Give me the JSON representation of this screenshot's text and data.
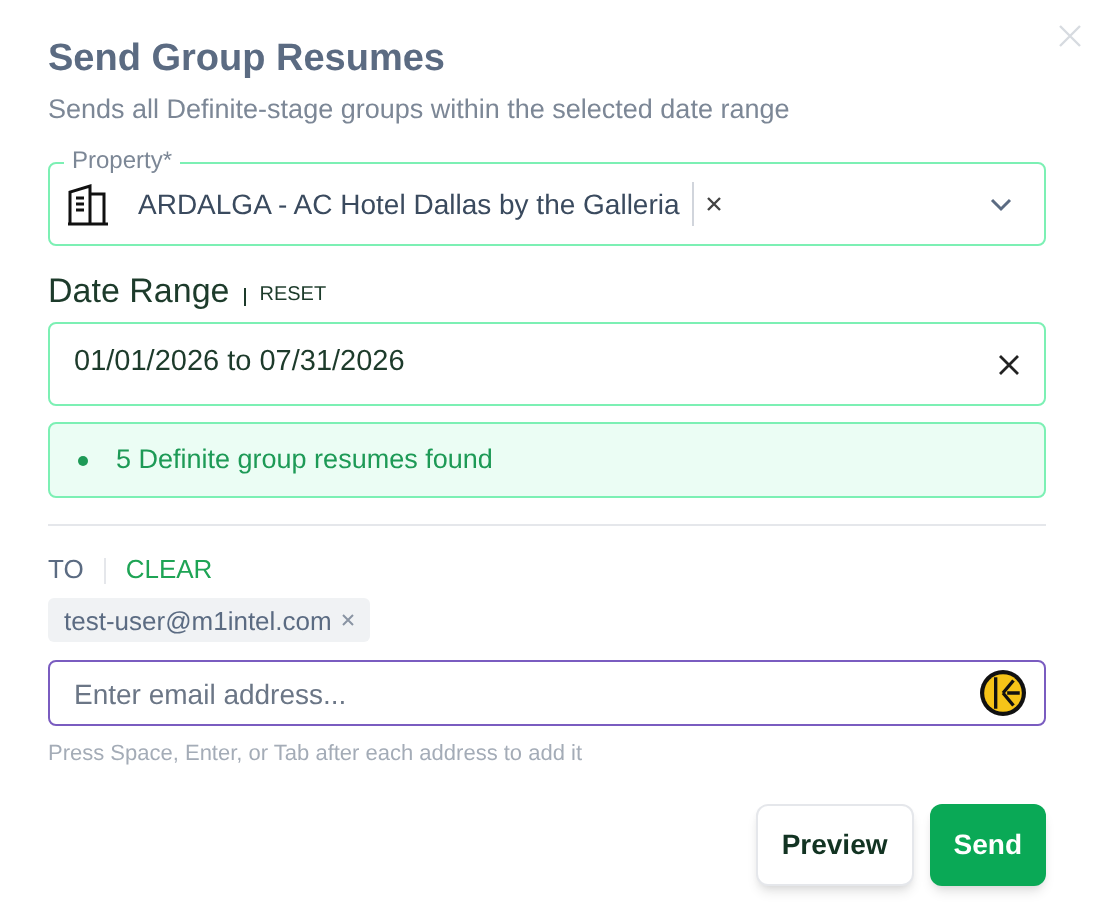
{
  "dialog": {
    "title": "Send Group Resumes",
    "subtitle": "Sends all Definite-stage groups within the selected date range"
  },
  "property": {
    "label": "Property*",
    "value": "ARDALGA - AC Hotel Dallas by the Galleria"
  },
  "date_range": {
    "label": "Date Range",
    "reset": "RESET",
    "value": "01/01/2026 to 07/31/2026"
  },
  "alert": {
    "text": "5 Definite group resumes found"
  },
  "recipients": {
    "label": "TO",
    "clear": "CLEAR",
    "chips": [
      "test-user@m1intel.com"
    ],
    "placeholder": "Enter email address...",
    "hint": "Press Space, Enter, or Tab after each address to add it"
  },
  "buttons": [
    {
      "label": "Preview",
      "kind": "secondary"
    },
    {
      "label": "Send",
      "kind": "primary"
    }
  ]
}
